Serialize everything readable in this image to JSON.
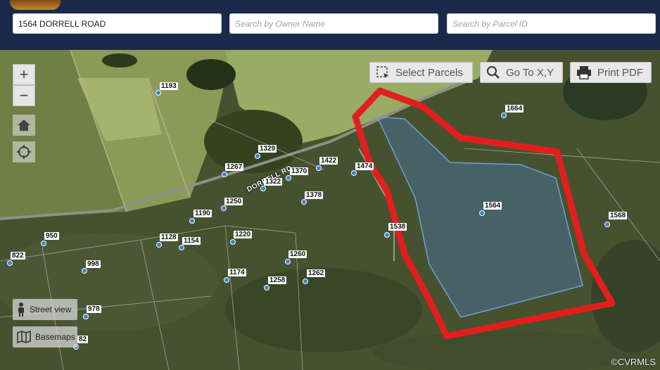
{
  "search": {
    "address_value": "1564 DORRELL ROAD",
    "owner_placeholder": "Search by Owner Name",
    "parcel_placeholder": "Search by Parcel ID"
  },
  "toolbar": {
    "select_parcels": "Select Parcels",
    "goto_xy": "Go To X,Y",
    "print_pdf": "Print PDF"
  },
  "zoom": {
    "in": "+",
    "out": "−"
  },
  "road_label": "DORRELL RD",
  "parcel_labels": [
    "1193",
    "1664",
    "1329",
    "1267",
    "1422",
    "1474",
    "1370",
    "1322",
    "1378",
    "1564",
    "1568",
    "1250",
    "1190",
    "1220",
    "1128",
    "1154",
    "950",
    "822",
    "998",
    "1260",
    "1174",
    "1258",
    "1262",
    "978",
    "82",
    "1538"
  ],
  "bottom": {
    "street_view": "Street view",
    "basemaps": "Basemaps"
  },
  "copyright": "©CVRMLS",
  "colors": {
    "header": "#1b2a4a",
    "boundary": "#e41e1e",
    "parcel_fill": "#4a7fc0"
  }
}
